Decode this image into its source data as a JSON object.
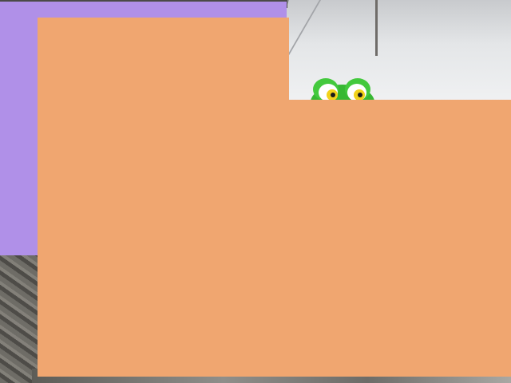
{
  "scene": {
    "description_colors": {
      "purple_block": "#b090e8",
      "orange_block": "#f0a670",
      "frog_green": "#3cc23a",
      "frog_eye_yellow": "#f2d21a"
    },
    "icons": {
      "frog": "frog-toy-icon"
    }
  }
}
